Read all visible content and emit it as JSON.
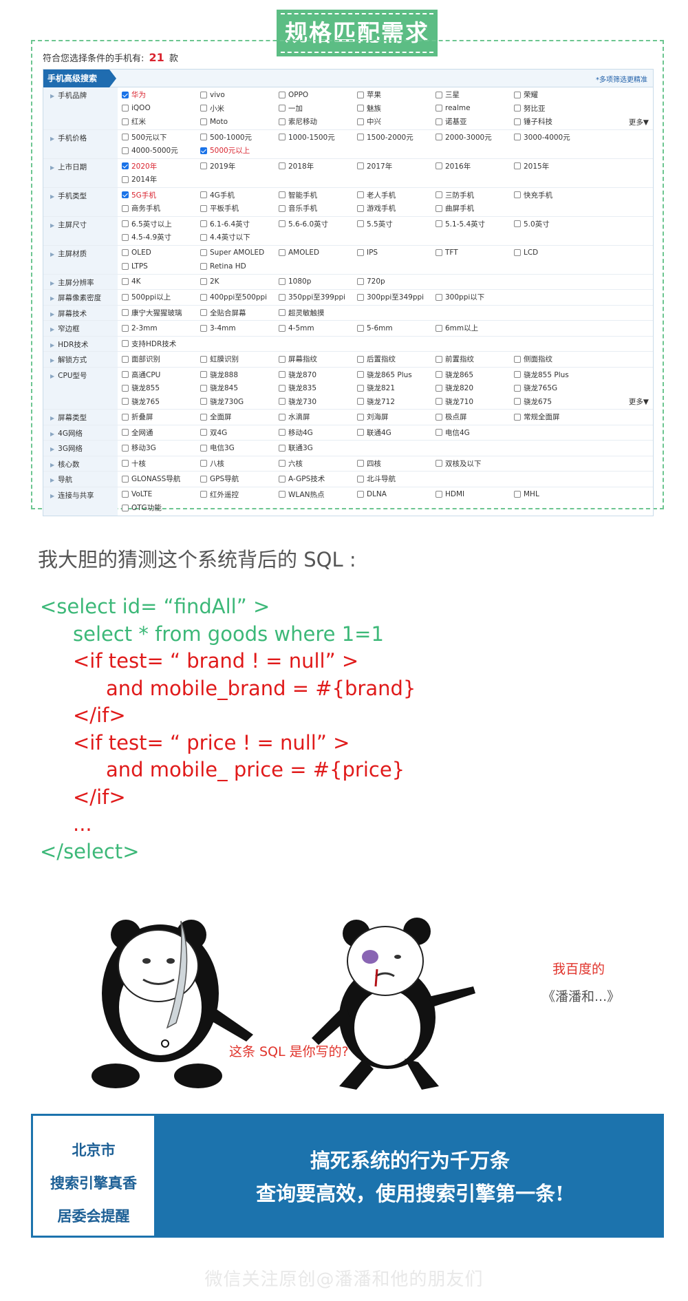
{
  "heading": "规格匹配需求",
  "result": {
    "prefix": "符合您选择条件的手机有:",
    "count": "21",
    "suffix": "款"
  },
  "panel": {
    "tab": "手机高级搜索",
    "link": "*多项筛选更精准"
  },
  "filters": [
    {
      "label": "手机品牌",
      "more": "更多▼",
      "options": [
        {
          "t": "华为",
          "c": true
        },
        {
          "t": "vivo"
        },
        {
          "t": "OPPO"
        },
        {
          "t": "苹果"
        },
        {
          "t": "三星"
        },
        {
          "t": "荣耀"
        },
        {
          "t": "iQOO"
        },
        {
          "t": "小米"
        },
        {
          "t": "一加"
        },
        {
          "t": "魅族"
        },
        {
          "t": "realme"
        },
        {
          "t": "努比亚"
        },
        {
          "t": "红米"
        },
        {
          "t": "Moto"
        },
        {
          "t": "索尼移动"
        },
        {
          "t": "中兴"
        },
        {
          "t": "诺基亚"
        },
        {
          "t": "锤子科技"
        }
      ]
    },
    {
      "label": "手机价格",
      "options": [
        {
          "t": "500元以下"
        },
        {
          "t": "500-1000元"
        },
        {
          "t": "1000-1500元"
        },
        {
          "t": "1500-2000元"
        },
        {
          "t": "2000-3000元"
        },
        {
          "t": "3000-4000元"
        },
        {
          "t": "4000-5000元"
        },
        {
          "t": "5000元以上",
          "c": true
        }
      ]
    },
    {
      "label": "上市日期",
      "options": [
        {
          "t": "2020年",
          "c": true
        },
        {
          "t": "2019年"
        },
        {
          "t": "2018年"
        },
        {
          "t": "2017年"
        },
        {
          "t": "2016年"
        },
        {
          "t": "2015年"
        },
        {
          "t": "2014年"
        }
      ]
    },
    {
      "label": "手机类型",
      "options": [
        {
          "t": "5G手机",
          "c": true
        },
        {
          "t": "4G手机"
        },
        {
          "t": "智能手机"
        },
        {
          "t": "老人手机"
        },
        {
          "t": "三防手机"
        },
        {
          "t": "快充手机"
        },
        {
          "t": "商务手机"
        },
        {
          "t": "平板手机"
        },
        {
          "t": "音乐手机"
        },
        {
          "t": "游戏手机"
        },
        {
          "t": "曲屏手机"
        }
      ]
    },
    {
      "label": "主屏尺寸",
      "options": [
        {
          "t": "6.5英寸以上"
        },
        {
          "t": "6.1-6.4英寸"
        },
        {
          "t": "5.6-6.0英寸"
        },
        {
          "t": "5.5英寸"
        },
        {
          "t": "5.1-5.4英寸"
        },
        {
          "t": "5.0英寸"
        },
        {
          "t": "4.5-4.9英寸"
        },
        {
          "t": "4.4英寸以下"
        }
      ]
    },
    {
      "label": "主屏材质",
      "options": [
        {
          "t": "OLED"
        },
        {
          "t": "Super AMOLED"
        },
        {
          "t": "AMOLED"
        },
        {
          "t": "IPS"
        },
        {
          "t": "TFT"
        },
        {
          "t": "LCD"
        },
        {
          "t": "LTPS"
        },
        {
          "t": "Retina HD"
        }
      ]
    },
    {
      "label": "主屏分辨率",
      "options": [
        {
          "t": "4K"
        },
        {
          "t": "2K"
        },
        {
          "t": "1080p"
        },
        {
          "t": "720p"
        }
      ]
    },
    {
      "label": "屏幕像素密度",
      "options": [
        {
          "t": "500ppi以上"
        },
        {
          "t": "400ppi至500ppi"
        },
        {
          "t": "350ppi至399ppi"
        },
        {
          "t": "300ppi至349ppi"
        },
        {
          "t": "300ppi以下"
        }
      ]
    },
    {
      "label": "屏幕技术",
      "options": [
        {
          "t": "康宁大猩猩玻璃"
        },
        {
          "t": "全贴合屏幕"
        },
        {
          "t": "超灵敏触摸"
        }
      ]
    },
    {
      "label": "窄边框",
      "options": [
        {
          "t": "2-3mm"
        },
        {
          "t": "3-4mm"
        },
        {
          "t": "4-5mm"
        },
        {
          "t": "5-6mm"
        },
        {
          "t": "6mm以上"
        }
      ]
    },
    {
      "label": "HDR技术",
      "options": [
        {
          "t": "支持HDR技术"
        }
      ]
    },
    {
      "label": "解锁方式",
      "options": [
        {
          "t": "面部识别"
        },
        {
          "t": "虹膜识别"
        },
        {
          "t": "屏幕指纹"
        },
        {
          "t": "后置指纹"
        },
        {
          "t": "前置指纹"
        },
        {
          "t": "侧面指纹"
        }
      ]
    },
    {
      "label": "CPU型号",
      "more": "更多▼",
      "options": [
        {
          "t": "高通CPU"
        },
        {
          "t": "骁龙888"
        },
        {
          "t": "骁龙870"
        },
        {
          "t": "骁龙865 Plus"
        },
        {
          "t": "骁龙865"
        },
        {
          "t": "骁龙855 Plus"
        },
        {
          "t": "骁龙855"
        },
        {
          "t": "骁龙845"
        },
        {
          "t": "骁龙835"
        },
        {
          "t": "骁龙821"
        },
        {
          "t": "骁龙820"
        },
        {
          "t": "骁龙765G"
        },
        {
          "t": "骁龙765"
        },
        {
          "t": "骁龙730G"
        },
        {
          "t": "骁龙730"
        },
        {
          "t": "骁龙712"
        },
        {
          "t": "骁龙710"
        },
        {
          "t": "骁龙675"
        }
      ]
    },
    {
      "label": "屏幕类型",
      "options": [
        {
          "t": "折叠屏"
        },
        {
          "t": "全面屏"
        },
        {
          "t": "水滴屏"
        },
        {
          "t": "刘海屏"
        },
        {
          "t": "极点屏"
        },
        {
          "t": "常规全面屏"
        }
      ]
    },
    {
      "label": "4G网络",
      "options": [
        {
          "t": "全网通"
        },
        {
          "t": "双4G"
        },
        {
          "t": "移动4G"
        },
        {
          "t": "联通4G"
        },
        {
          "t": "电信4G"
        }
      ]
    },
    {
      "label": "3G网络",
      "options": [
        {
          "t": "移动3G"
        },
        {
          "t": "电信3G"
        },
        {
          "t": "联通3G"
        }
      ]
    },
    {
      "label": "核心数",
      "options": [
        {
          "t": "十核"
        },
        {
          "t": "八核"
        },
        {
          "t": "六核"
        },
        {
          "t": "四核"
        },
        {
          "t": "双核及以下"
        }
      ]
    },
    {
      "label": "导航",
      "options": [
        {
          "t": "GLONASS导航"
        },
        {
          "t": "GPS导航"
        },
        {
          "t": "A-GPS技术"
        },
        {
          "t": "北斗导航"
        }
      ]
    },
    {
      "label": "连接与共享",
      "options": [
        {
          "t": "VoLTE"
        },
        {
          "t": "红外遥控"
        },
        {
          "t": "WLAN热点"
        },
        {
          "t": "DLNA"
        },
        {
          "t": "HDMI"
        },
        {
          "t": "MHL"
        },
        {
          "t": "OTG功能"
        }
      ]
    }
  ],
  "guess": "我大胆的猜测这个系统背后的 SQL :",
  "code": [
    {
      "text": "<select id= “findAll” >",
      "color": "green",
      "indent": 0
    },
    {
      "text": "select * from goods where 1=1",
      "color": "green",
      "indent": 1
    },
    {
      "text": "<if test= “ brand ! = null” >",
      "color": "red",
      "indent": 1
    },
    {
      "text": "and mobile_brand = #{brand}",
      "color": "red",
      "indent": 2
    },
    {
      "text": "</if>",
      "color": "red",
      "indent": 1
    },
    {
      "text": "<if test= “ price ! = null” >",
      "color": "red",
      "indent": 1
    },
    {
      "text": "and mobile_ price = #{price}",
      "color": "red",
      "indent": 2
    },
    {
      "text": "</if>",
      "color": "red",
      "indent": 1
    },
    {
      "text": "...",
      "color": "red",
      "indent": 1
    },
    {
      "text": "</select>",
      "color": "green",
      "indent": 0
    }
  ],
  "meme": {
    "caption_left": "这条 SQL 是你写的?",
    "caption_right_1": "我百度的",
    "caption_right_2": "《潘潘和...》"
  },
  "banner": {
    "left": [
      "北京市",
      "搜索引擎真香",
      "居委会提醒"
    ],
    "right": [
      "搞死系统的行为千万条",
      "查询要高效，使用搜索引擎第一条!"
    ]
  },
  "watermark": "微信关注原创@潘潘和他的朋友们"
}
